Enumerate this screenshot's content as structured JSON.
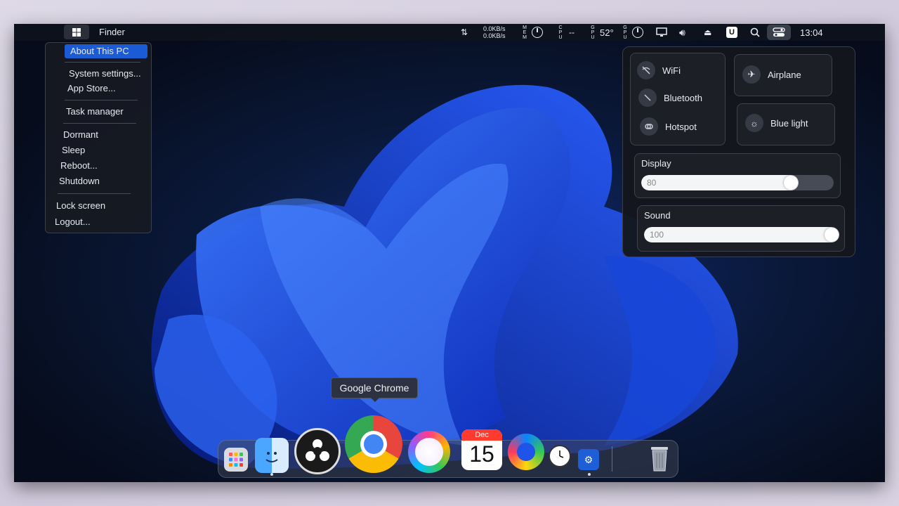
{
  "menubar": {
    "app_name": "Finder",
    "net_up": "0.0KB/s",
    "net_down": "0.0KB/s",
    "mem_label": "MEM",
    "cpu_label": "CPU",
    "cpu_value": "--",
    "gpu_label": "GPU",
    "temp": "52°",
    "gpu_label2": "GPU",
    "time": "13:04",
    "u_badge": "U"
  },
  "apple_menu": {
    "items": [
      "About This PC",
      "System settings...",
      "App Store...",
      "Task manager",
      "Dormant",
      "Sleep",
      "Reboot...",
      "Shutdown",
      "Lock screen",
      "Logout..."
    ]
  },
  "control_center": {
    "wifi_label": "WiFi",
    "bluetooth_label": "Bluetooth",
    "hotspot_label": "Hotspot",
    "airplane_label": "Airplane",
    "bluelight_label": "Blue light",
    "display_label": "Display",
    "display_value": "80",
    "display_fraction": 0.8,
    "sound_label": "Sound",
    "sound_value": "100",
    "sound_fraction": 1.0
  },
  "dock": {
    "tooltip": "Google Chrome",
    "calendar_month": "Dec",
    "calendar_day": "15",
    "apps": [
      "launchpad-icon",
      "finder-icon",
      "obs-icon",
      "chrome-icon",
      "paint-icon",
      "calendar-icon",
      "edge-icon",
      "clock-icon",
      "settings-icon",
      "trash-icon"
    ]
  },
  "colors": {
    "accent": "#1b5cd6",
    "wallpaper": "#1f54e8"
  }
}
